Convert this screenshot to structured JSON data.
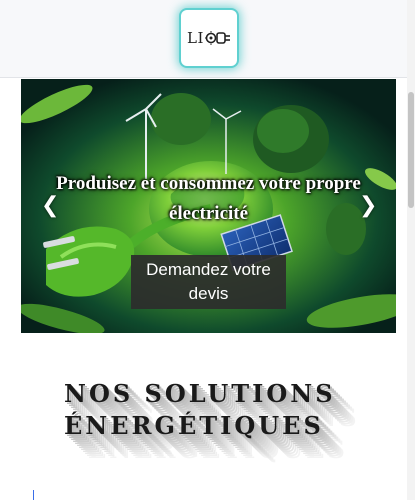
{
  "header": {
    "logo_text": "LI",
    "logo_icon": "plug-icon"
  },
  "carousel": {
    "caption": "Produisez et consommez votre propre électricité",
    "cta_label": "Demandez votre devis",
    "prev_icon": "chevron-left-icon",
    "next_icon": "chevron-right-icon",
    "prev_glyph": "❮",
    "next_glyph": "❯"
  },
  "section": {
    "title_line1": "NOS SOLUTIONS",
    "title_line2": "ÉNERGÉTIQUES"
  },
  "colors": {
    "logo_glow": "#40c4c4",
    "plug_green": "#5cc42b",
    "cta_bg": "#2d2d2d"
  }
}
